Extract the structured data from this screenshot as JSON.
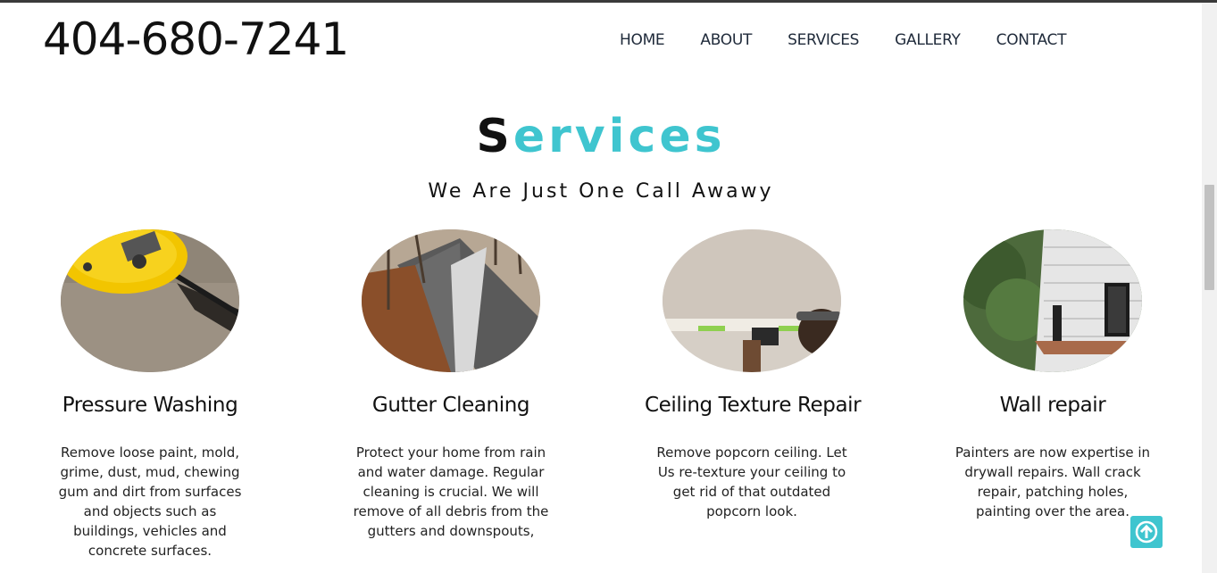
{
  "header": {
    "phone": "404-680-7241",
    "nav": [
      "HOME",
      "ABOUT",
      "SERVICES",
      "GALLERY",
      "CONTACT"
    ]
  },
  "services_section": {
    "title_first_letter": "S",
    "title_rest": "ervices",
    "subtitle": "We Are Just One Call Awawy",
    "accent_color": "#3fc5cf",
    "cards": [
      {
        "title": "Pressure Washing",
        "description": "Remove loose paint, mold, grime, dust, mud, chewing gum and dirt from surfaces and objects such as buildings, vehicles and concrete surfaces.",
        "image": "pressure-washer-photo"
      },
      {
        "title": "Gutter Cleaning",
        "description": "Protect your home from rain and water damage. Regular cleaning is crucial. We will remove of all debris from the gutters and downspouts,",
        "image": "roof-gutter-photo"
      },
      {
        "title": "Ceiling Texture Repair",
        "description": "Remove popcorn ceiling. Let Us re-texture your ceiling to get rid of that outdated popcorn look.",
        "image": "ceiling-worker-photo"
      },
      {
        "title": "Wall repair",
        "description": "Painters are now expertise in drywall repairs. Wall crack repair, patching holes, painting over the area.",
        "image": "house-siding-photo"
      }
    ]
  },
  "back_to_top": {
    "icon": "arrow-up-icon"
  }
}
